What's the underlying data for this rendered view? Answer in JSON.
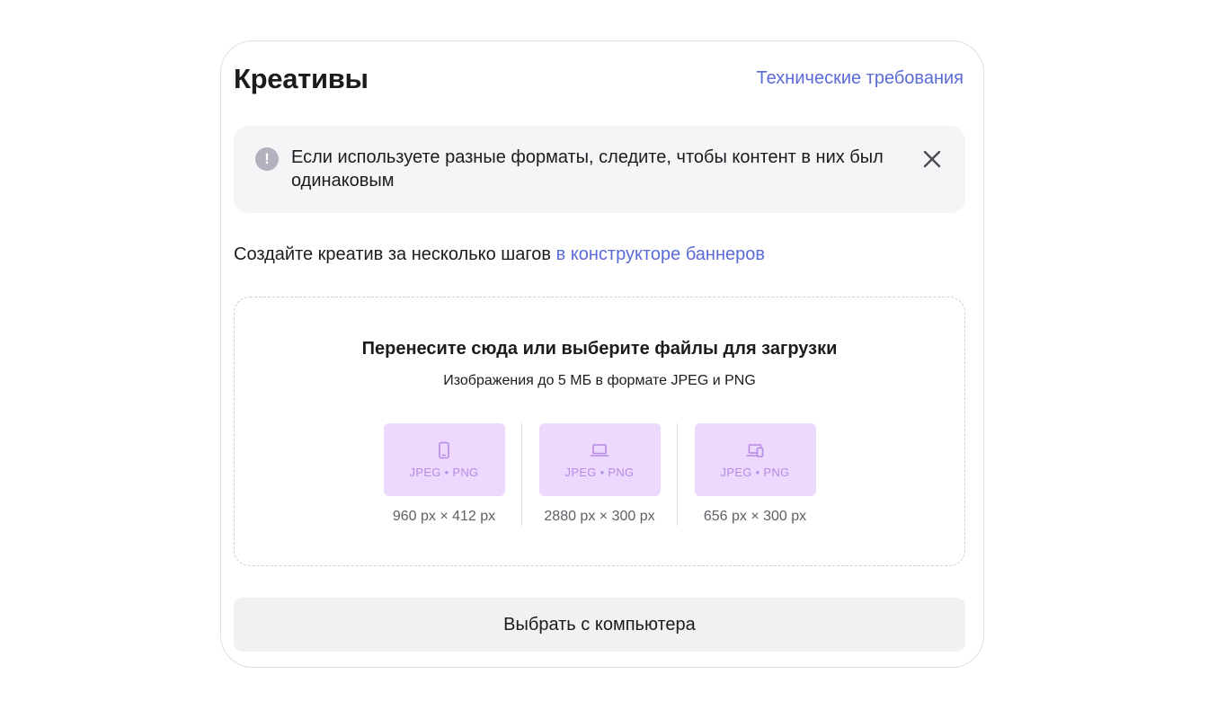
{
  "header": {
    "title": "Креативы",
    "tech_link": "Технические требования"
  },
  "notice": {
    "icon": "exclamation-icon",
    "icon_glyph": "!",
    "text": "Если используете разные форматы, следите, чтобы контент в них был одинаковым"
  },
  "constructor": {
    "prefix": "Создайте креатив за несколько шагов ",
    "link": "в конструкторе баннеров"
  },
  "dropzone": {
    "title": "Перенесите сюда или выберите файлы для загрузки",
    "subtitle": "Изображения до 5 МБ в формате JPEG и PNG",
    "formats": [
      {
        "icon": "phone-icon",
        "label": "JPEG • PNG",
        "size": "960 px × 412 px"
      },
      {
        "icon": "laptop-icon",
        "label": "JPEG • PNG",
        "size": "2880 px × 300 px"
      },
      {
        "icon": "devices-icon",
        "label": "JPEG • PNG",
        "size": "656 px × 300 px"
      }
    ]
  },
  "pick_button": "Выбрать с компьютера",
  "colors": {
    "accent": "#5b6bd6",
    "tile_bg": "#ecd9fd",
    "tile_fg": "#b68ae6",
    "notice_bg": "#f5f5f8",
    "button_bg": "#f1f1f2"
  }
}
